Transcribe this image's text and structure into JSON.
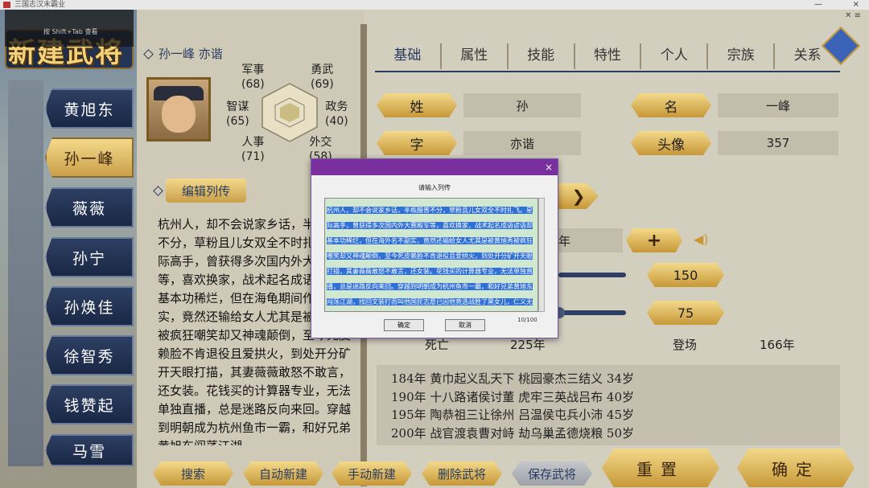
{
  "window": {
    "title": "三国志汉末霸业"
  },
  "overlay_hint": "按 Shift+Tab 查看",
  "header": {
    "logo_text": "新建武将",
    "character_name": "孙一峰 亦谐"
  },
  "sidebar": {
    "items": [
      {
        "label": "黄旭东"
      },
      {
        "label": "孙一峰"
      },
      {
        "label": "薇薇"
      },
      {
        "label": "孙宁"
      },
      {
        "label": "孙焕佳"
      },
      {
        "label": "徐智秀"
      },
      {
        "label": "钱赞起"
      },
      {
        "label": "马雪"
      }
    ]
  },
  "stats": {
    "military": {
      "label": "军事",
      "value": "(68)"
    },
    "valor": {
      "label": "勇武",
      "value": "(69)"
    },
    "intellect": {
      "label": "智谋",
      "value": "(65)"
    },
    "politics": {
      "label": "政务",
      "value": "(40)"
    },
    "personnel": {
      "label": "人事",
      "value": "(71)"
    },
    "diplomacy": {
      "label": "外交",
      "value": "(58)"
    }
  },
  "edit_bio_label": "编辑列传",
  "bio_text": "杭州人，却不会说家乡话，半瓶醋普不分，草粉且儿女双全不时扎飞。星际高手，曾获得多次国内外大赛殿军等，喜欢换家，战术起名成语谚语却基本功稀烂，但在海龟期间作为副实，竟然还输给女人尤其是被黄旭秀被疯狂嘲笑却又神魂颠倒，至今死皮赖脸不肯退役且爱拱火，到处开分矿开天眼打描，其妻薇薇敢怒不敢言，还女装。花钱买的计算器专业，无法单独直播，总是迷路反向来回。穿越到明朝成为杭州鱼市一霸，和好兄弟黄旭东闯荡江湖，",
  "tabs": [
    {
      "label": "基础"
    },
    {
      "label": "属性"
    },
    {
      "label": "技能"
    },
    {
      "label": "特性"
    },
    {
      "label": "个人"
    },
    {
      "label": "宗族"
    },
    {
      "label": "关系"
    }
  ],
  "basic": {
    "surname_label": "姓",
    "surname_value": "孙",
    "given_label": "名",
    "given_value": "一峰",
    "courtesy_label": "字",
    "courtesy_value": "亦谐",
    "portrait_label": "头像",
    "portrait_value": "357",
    "year_suffix": "年",
    "slider1_value": "150",
    "slider2_value": "75",
    "death_label": "死亡",
    "death_value": "225年",
    "debut_label": "登场",
    "debut_value": "166年"
  },
  "events": [
    "184年 黄巾起义乱天下 桃园豪杰三结义 34岁",
    "190年 十八路诸侯讨董 虎牢三英战吕布 40岁",
    "195年 陶恭祖三让徐州 吕温侯屯兵小沛 45岁",
    "200年 战官渡袁曹对峙 劫乌巢孟德烧粮 50岁"
  ],
  "bottom_buttons": {
    "search": "搜索",
    "auto_create": "自动新建",
    "manual_create": "手动新建",
    "delete": "删除武将",
    "save": "保存武将",
    "reset": "重置",
    "confirm": "确定"
  },
  "dialog": {
    "title": "",
    "close": "×",
    "prompt": "请输入列传",
    "text": "杭州人，却不会说家乡话，半瓶醋普不分，草粉且儿女双全不时扎飞。星际高手，曾获得多次国内外大赛殿军等，喜欢换家，战术起名成语谚语却基本功稀烂，但在海外名不副实，竟然还输给女人尤其是被黄旭秀被疯狂嘲笑却又神魂颠倒，至今死皮赖脸不肯退役且爱拱火，到处开分矿开天眼打描，其妻薇薇敢怒不敢言，还女装。花钱买的计算器专业，无法单独直播，总是迷路反向来回。穿越到明朝成为杭州鱼市一霸，和好兄弟黄旭东闯荡江湖，找回文装打而叫他国民志愿已因他竟选战胜了黑女儿，仁义无双，时常强调自己忠义到左胯门上，虽然还开分了一届银行，只通不出！他会和一同穿越过来的黄他以此和人生生八十回？",
    "count": "10/100",
    "ok": "确定",
    "cancel": "取消"
  }
}
